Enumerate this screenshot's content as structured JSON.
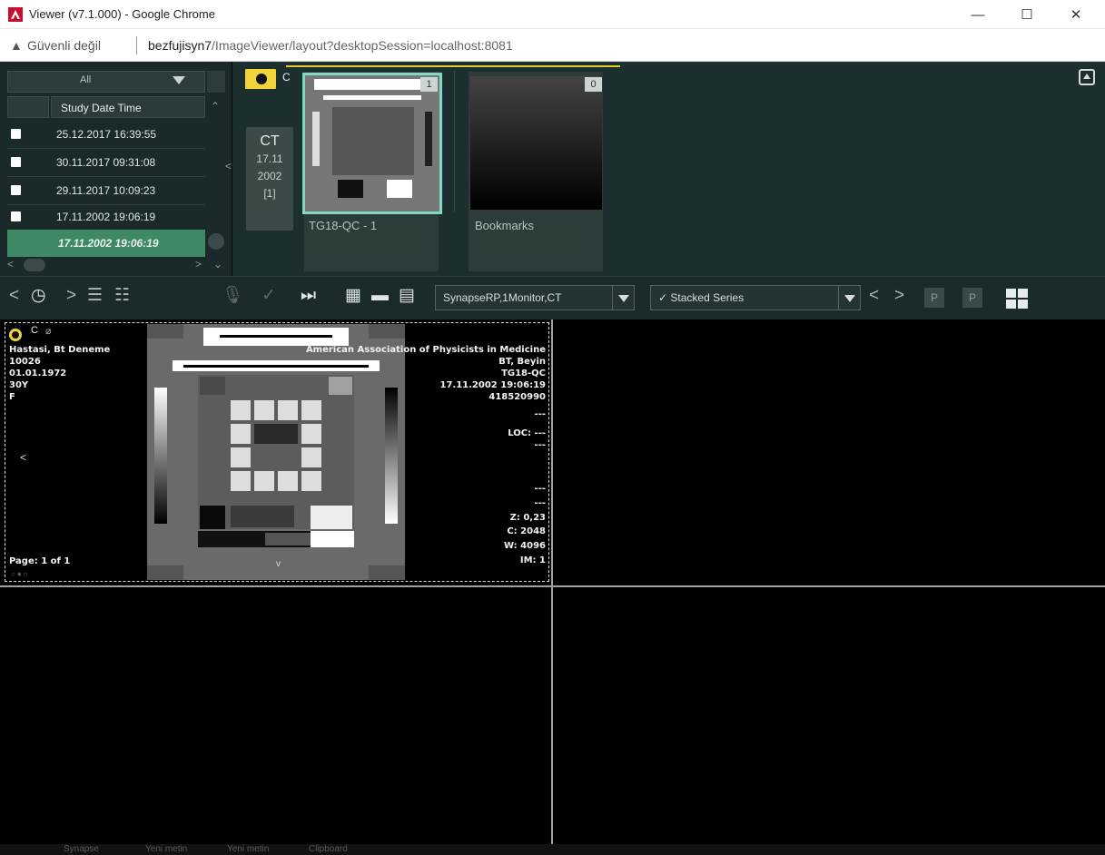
{
  "window": {
    "title": "Viewer (v7.1.000) - Google Chrome",
    "minimize": "—",
    "maximize": "☐",
    "close": "✕"
  },
  "address": {
    "warning": "Güvenli değil",
    "url_host": "bezfujisyn7",
    "url_path": "/ImageViewer/layout?desktopSession=localhost:8081"
  },
  "study_list": {
    "filter": "All",
    "column_header": "Study Date Time",
    "rows": [
      {
        "date": "25.12.2017 16:39:55"
      },
      {
        "date": "30.11.2017 09:31:08"
      },
      {
        "date": "29.11.2017 10:09:23"
      },
      {
        "date": "17.11.2002 19:06:19"
      }
    ],
    "selected": "17.11.2002 19:06:19"
  },
  "series": {
    "tag_label": "C",
    "study_chip": {
      "modality": "CT",
      "day_month": "17.11",
      "year": "2002",
      "count": "[1]"
    },
    "thumbnails": [
      {
        "label": "TG18-QC - 1",
        "badge": "1"
      },
      {
        "label": "Bookmarks",
        "badge": "0"
      }
    ]
  },
  "toolbar": {
    "protocol": "SynapseRP,1Monitor,CT",
    "mode": "✓ Stacked Series",
    "p_label": "P"
  },
  "viewport": {
    "tag": "C",
    "patient_name": "Hastasi, Bt Deneme",
    "patient_id": "10026",
    "birth_date": "01.01.1972",
    "age": "30Y",
    "sex": "F",
    "institution": "American Association of Physicists in Medicine",
    "body_part": "BT, Beyin",
    "series_desc": "TG18-QC",
    "datetime": "17.11.2002 19:06:19",
    "accession": "418520990",
    "dash1": "---",
    "loc": "LOC: ---",
    "dash2": "---",
    "dash3": "---",
    "dash4": "---",
    "zoom": "Z: 0,23",
    "center": "C: 2048",
    "width": "W: 4096",
    "image_number": "IM: 1",
    "page": "Page: 1 of 1",
    "left_arrow": "<",
    "down_arrow": "v"
  },
  "bottom_taskbar": [
    "Synapse",
    "Yeni metin",
    "Yeni metin",
    "Clipboard"
  ]
}
